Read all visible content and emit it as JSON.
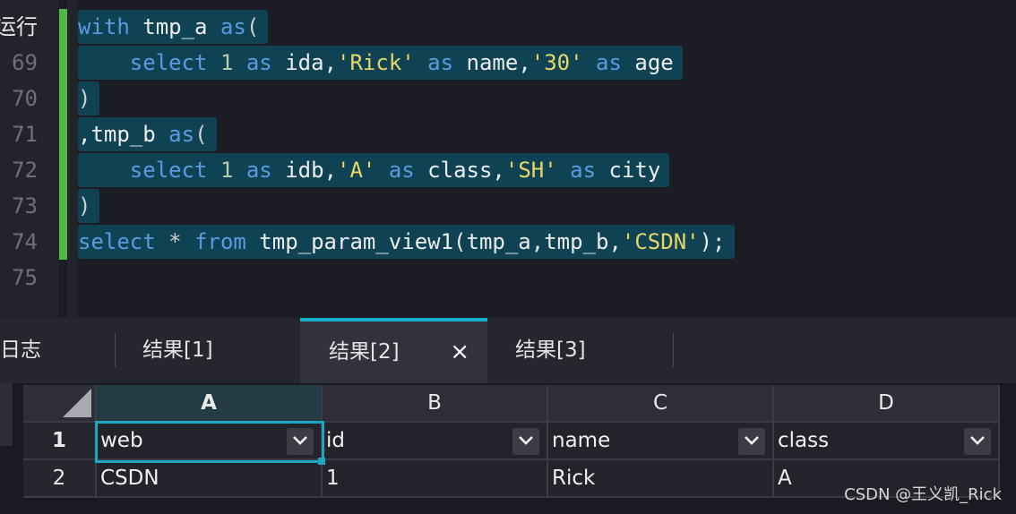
{
  "editor": {
    "current_line_label": "运行",
    "line_numbers": [
      "69",
      "70",
      "71",
      "72",
      "73",
      "74",
      "75"
    ],
    "lines": [
      [
        {
          "t": "with",
          "c": "kw"
        },
        {
          "t": " tmp_a ",
          "c": "fn"
        },
        {
          "t": "as",
          "c": "kw"
        },
        {
          "t": "(",
          "c": "op"
        }
      ],
      [
        {
          "t": "    ",
          "c": "op"
        },
        {
          "t": "select",
          "c": "kw"
        },
        {
          "t": " ",
          "c": "op"
        },
        {
          "t": "1",
          "c": "num"
        },
        {
          "t": " ",
          "c": "op"
        },
        {
          "t": "as",
          "c": "kw"
        },
        {
          "t": " ida,",
          "c": "fn"
        },
        {
          "t": "'Rick'",
          "c": "str"
        },
        {
          "t": " ",
          "c": "op"
        },
        {
          "t": "as",
          "c": "kw"
        },
        {
          "t": " name,",
          "c": "fn"
        },
        {
          "t": "'30'",
          "c": "str"
        },
        {
          "t": " ",
          "c": "op"
        },
        {
          "t": "as",
          "c": "kw"
        },
        {
          "t": " age",
          "c": "fn"
        }
      ],
      [
        {
          "t": ")",
          "c": "op"
        }
      ],
      [
        {
          "t": ",tmp_b ",
          "c": "fn"
        },
        {
          "t": "as",
          "c": "kw"
        },
        {
          "t": "(",
          "c": "op"
        }
      ],
      [
        {
          "t": "    ",
          "c": "op"
        },
        {
          "t": "select",
          "c": "kw"
        },
        {
          "t": " ",
          "c": "op"
        },
        {
          "t": "1",
          "c": "num"
        },
        {
          "t": " ",
          "c": "op"
        },
        {
          "t": "as",
          "c": "kw"
        },
        {
          "t": " idb,",
          "c": "fn"
        },
        {
          "t": "'A'",
          "c": "str"
        },
        {
          "t": " ",
          "c": "op"
        },
        {
          "t": "as",
          "c": "kw"
        },
        {
          "t": " class,",
          "c": "fn"
        },
        {
          "t": "'SH'",
          "c": "str"
        },
        {
          "t": " ",
          "c": "op"
        },
        {
          "t": "as",
          "c": "kw"
        },
        {
          "t": " city",
          "c": "fn"
        }
      ],
      [
        {
          "t": ")",
          "c": "op"
        }
      ],
      [
        {
          "t": "select",
          "c": "kw"
        },
        {
          "t": " * ",
          "c": "op"
        },
        {
          "t": "from",
          "c": "kw"
        },
        {
          "t": " tmp_param_view1(tmp_a,tmp_b,",
          "c": "fn"
        },
        {
          "t": "'CSDN'",
          "c": "str"
        },
        {
          "t": ");",
          "c": "fn"
        }
      ]
    ]
  },
  "tabs": {
    "log_label": "日志",
    "items": [
      "结果[1]",
      "结果[2]",
      "结果[3]"
    ],
    "active_index": 1,
    "close_symbol": "×"
  },
  "grid": {
    "column_letters": [
      "A",
      "B",
      "C",
      "D"
    ],
    "row_numbers": [
      "1",
      "2"
    ],
    "header_row": [
      "web",
      "id",
      "name",
      "class"
    ],
    "data_row": [
      "CSDN",
      "1",
      "Rick",
      "A"
    ]
  },
  "watermark": "CSDN @王义凯_Rick",
  "colors": {
    "accent": "#15aecd",
    "selection": "#0f4252",
    "gutter_marker": "#4fb947",
    "keyword": "#5a9be0",
    "string": "#e6d767"
  }
}
